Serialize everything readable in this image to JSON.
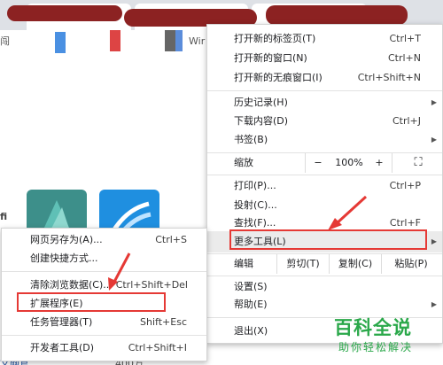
{
  "colors": {
    "menu_bg": "#ffffff",
    "hover_bg": "#ebebeb",
    "highlight_red": "#e53935",
    "watermark_green": "#2aa84a"
  },
  "page": {
    "left_fragment": "闯",
    "win_fragment": "Wir",
    "tile_left_fragment": "fi",
    "bottom_left_fragment": "文网官",
    "bottom_mid_fragment": "400万"
  },
  "main_menu": {
    "new_tab": {
      "label": "打开新的标签页(T)",
      "shortcut": "Ctrl+T"
    },
    "new_window": {
      "label": "打开新的窗口(N)",
      "shortcut": "Ctrl+N"
    },
    "incognito": {
      "label": "打开新的无痕窗口(I)",
      "shortcut": "Ctrl+Shift+N"
    },
    "history": {
      "label": "历史记录(H)",
      "arrow": "▶"
    },
    "downloads": {
      "label": "下载内容(D)",
      "shortcut": "Ctrl+J"
    },
    "bookmarks": {
      "label": "书签(B)",
      "arrow": "▶"
    },
    "zoom": {
      "label": "缩放",
      "minus": "−",
      "value": "100%",
      "plus": "+",
      "fullscreen": "⛶"
    },
    "print": {
      "label": "打印(P)...",
      "shortcut": "Ctrl+P"
    },
    "cast": {
      "label": "投射(C)..."
    },
    "find": {
      "label": "查找(F)...",
      "shortcut": "Ctrl+F"
    },
    "more_tools": {
      "label": "更多工具(L)",
      "arrow": "▶"
    },
    "edit": {
      "label": "编辑",
      "cut": "剪切(T)",
      "copy": "复制(C)",
      "paste": "粘贴(P)"
    },
    "settings": {
      "label": "设置(S)"
    },
    "help": {
      "label": "帮助(E)",
      "arrow": "▶"
    },
    "exit": {
      "label": "退出(X)"
    }
  },
  "submenu": {
    "save_page": {
      "label": "网页另存为(A)...",
      "shortcut": "Ctrl+S"
    },
    "create_shortcut": {
      "label": "创建快捷方式..."
    },
    "clear_data": {
      "label": "清除浏览数据(C)...",
      "shortcut": "Ctrl+Shift+Del"
    },
    "extensions": {
      "label": "扩展程序(E)"
    },
    "task_manager": {
      "label": "任务管理器(T)",
      "shortcut": "Shift+Esc"
    },
    "dev_tools": {
      "label": "开发者工具(D)",
      "shortcut": "Ctrl+Shift+I"
    }
  },
  "watermark": {
    "line1": "百科全说",
    "line2": "助你轻松解决"
  }
}
